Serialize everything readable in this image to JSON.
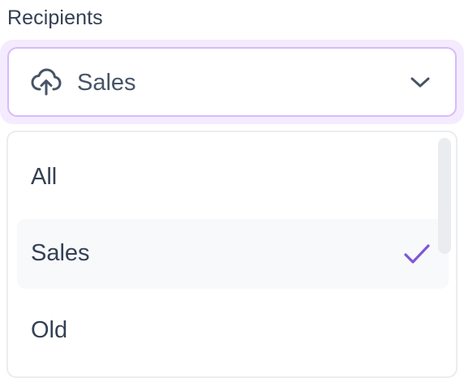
{
  "field": {
    "label": "Recipients"
  },
  "select": {
    "icon": "upload-cloud-icon",
    "value": "Sales",
    "chevron_icon": "chevron-down-icon"
  },
  "menu": {
    "options": [
      {
        "label": "All",
        "selected": false
      },
      {
        "label": "Sales",
        "selected": true
      },
      {
        "label": "Old",
        "selected": false
      }
    ],
    "check_icon": "check-icon"
  },
  "colors": {
    "text_primary": "#344054",
    "text_secondary": "#475467",
    "focus_border": "#d6bbfb",
    "focus_ring": "#f4ebff",
    "check": "#7f56d9",
    "menu_border": "#eaecf0",
    "selected_bg": "#f8f9fb"
  }
}
